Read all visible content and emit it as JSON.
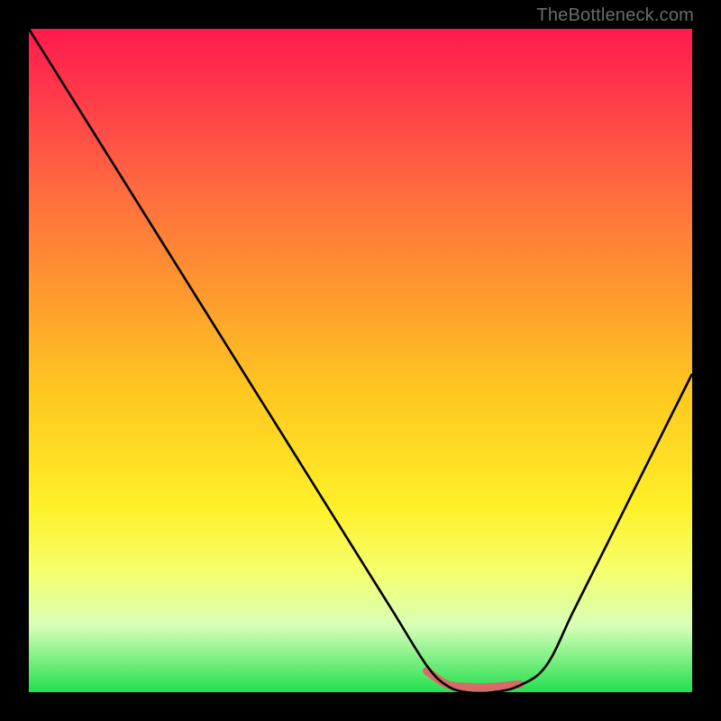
{
  "watermark": "TheBottleneck.com",
  "chart_data": {
    "type": "line",
    "title": "",
    "xlabel": "",
    "ylabel": "",
    "xlim": [
      0,
      100
    ],
    "ylim": [
      0,
      100
    ],
    "grid": false,
    "legend": false,
    "background_gradient": {
      "top": "#ff1a4d",
      "mid": "#ffe030",
      "bottom": "#22e04e"
    },
    "series": [
      {
        "name": "curve",
        "color": "#000000",
        "x": [
          0,
          5,
          10,
          15,
          20,
          25,
          30,
          35,
          40,
          45,
          50,
          55,
          60,
          63,
          66,
          70,
          74,
          78,
          82,
          86,
          90,
          95,
          100
        ],
        "y": [
          100,
          92,
          84,
          76,
          68,
          60,
          52,
          44,
          36,
          28,
          20,
          12,
          4,
          1,
          0,
          0,
          1,
          4,
          12,
          20,
          28,
          38,
          48
        ]
      },
      {
        "name": "bottom-highlight",
        "color": "#d86a6a",
        "x": [
          60,
          63,
          66,
          70,
          74
        ],
        "y": [
          3.2,
          1.2,
          0.8,
          0.8,
          1.2
        ]
      }
    ]
  }
}
